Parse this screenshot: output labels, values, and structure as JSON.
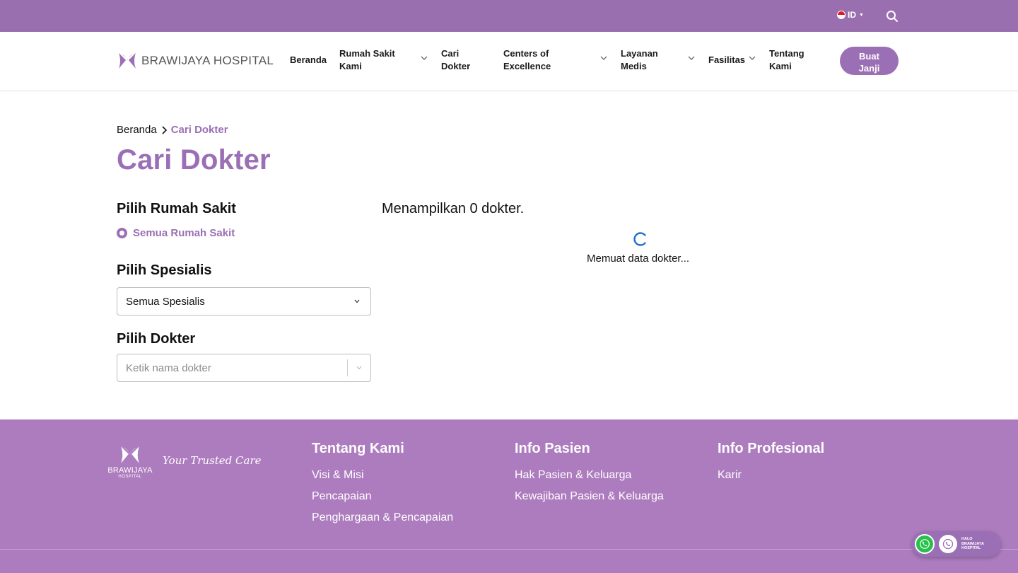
{
  "topbar": {
    "language": "ID"
  },
  "nav": {
    "brand": "BRAWIJAYA HOSPITAL",
    "items": [
      {
        "label_line1": "Beranda",
        "label_line2": ""
      },
      {
        "label_line1": "Rumah Sakit",
        "label_line2": "Kami"
      },
      {
        "label_line1": "Cari",
        "label_line2": "Dokter"
      },
      {
        "label_line1": "Centers of",
        "label_line2": "Excellence"
      },
      {
        "label_line1": "Layanan",
        "label_line2": "Medis"
      },
      {
        "label_line1": "Fasilitas",
        "label_line2": ""
      },
      {
        "label_line1": "Tentang",
        "label_line2": "Kami"
      }
    ],
    "cta_line1": "Buat",
    "cta_line2": "Janji"
  },
  "breadcrumb": {
    "home": "Beranda",
    "current": "Cari Dokter"
  },
  "page": {
    "title": "Cari Dokter"
  },
  "filters": {
    "hospital_title": "Pilih Rumah Sakit",
    "hospital_option": "Semua Rumah Sakit",
    "specialist_title": "Pilih Spesialis",
    "specialist_value": "Semua Spesialis",
    "doctor_title": "Pilih Dokter",
    "doctor_placeholder": "Ketik nama dokter"
  },
  "results": {
    "count_text": "Menampilkan 0 dokter.",
    "loading_text": "Memuat data dokter..."
  },
  "footer": {
    "logo_name": "BRAWIJAYA",
    "logo_sub": "HOSPITAL",
    "tagline": "Your Trusted Care",
    "col1": {
      "title": "Tentang Kami",
      "links": [
        "Visi & Misi",
        "Pencapaian",
        "Penghargaan & Pencapaian"
      ]
    },
    "col2": {
      "title": "Info Pasien",
      "links": [
        "Hak Pasien & Keluarga",
        "Kewajiban Pasien & Keluarga"
      ]
    },
    "col3": {
      "title": "Info Profesional",
      "links": [
        "Karir"
      ]
    }
  },
  "contact": {
    "line1": "HALO",
    "line2": "BRAWIJAYA",
    "line3": "HOSPITAL"
  },
  "colors": {
    "brand_purple": "#9b6fb5",
    "topbar": "#996fb0",
    "footer": "#ad7cbe",
    "spinner": "#1f6fd1",
    "whatsapp": "#27c04a"
  },
  "icons": [
    "flag-id-icon",
    "search-icon",
    "logo-butterfly-icon",
    "chevron-down-icon",
    "chevron-right-icon",
    "spinner-icon",
    "whatsapp-icon",
    "phone-icon"
  ]
}
